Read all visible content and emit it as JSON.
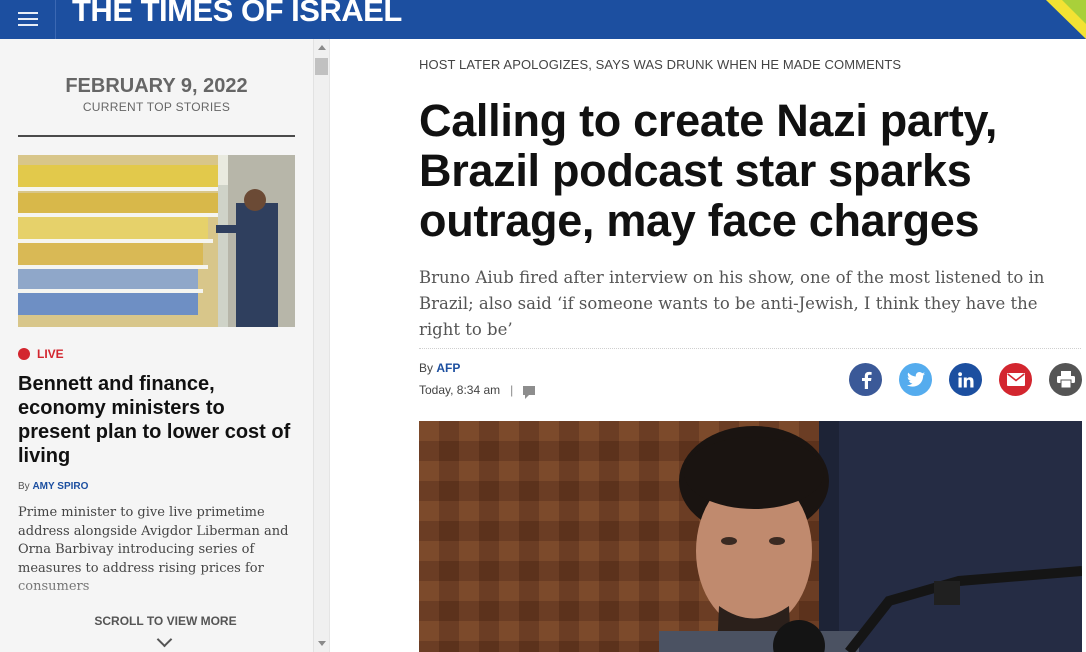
{
  "site": {
    "logo": "THE TIMES OF ISRAEL"
  },
  "sidebar": {
    "date": "FEBRUARY 9, 2022",
    "date_sub": "CURRENT TOP STORIES",
    "live_label": "LIVE",
    "headline": "Bennett and finance, economy ministers to present plan to lower cost of living",
    "byline_prefix": "By",
    "author": "AMY SPIRO",
    "description": "Prime minister to give live primetime address alongside Avigdor Liberman and Orna Barbivay introducing series of measures to address rising prices for consumers",
    "scroll_more": "SCROLL TO VIEW MORE"
  },
  "article": {
    "kicker": "HOST LATER APOLOGIZES, SAYS WAS DRUNK WHEN HE MADE COMMENTS",
    "headline": "Calling to create Nazi party, Brazil podcast star sparks outrage, may face charges",
    "subtitle": "Bruno Aiub fired after interview on his show, one of the most listened to in Brazil; also said ‘if someone wants to be anti-Jewish, I think they have the right to be’",
    "byline_prefix": "By",
    "author": "AFP",
    "timestamp": "Today, 8:34 am",
    "separator": "|"
  },
  "share_buttons": [
    {
      "name": "facebook",
      "color": "#3b5998",
      "icon": "facebook-icon"
    },
    {
      "name": "twitter",
      "color": "#55acee",
      "icon": "twitter-icon"
    },
    {
      "name": "linkedin",
      "color": "#1c4fa0",
      "icon": "linkedin-icon"
    },
    {
      "name": "email",
      "color": "#d3262f",
      "icon": "email-icon"
    },
    {
      "name": "print",
      "color": "#555555",
      "icon": "print-icon"
    }
  ],
  "colors": {
    "brand_blue": "#1c4fa0",
    "live_red": "#d3262f",
    "accent_yellow": "#f2e233"
  }
}
